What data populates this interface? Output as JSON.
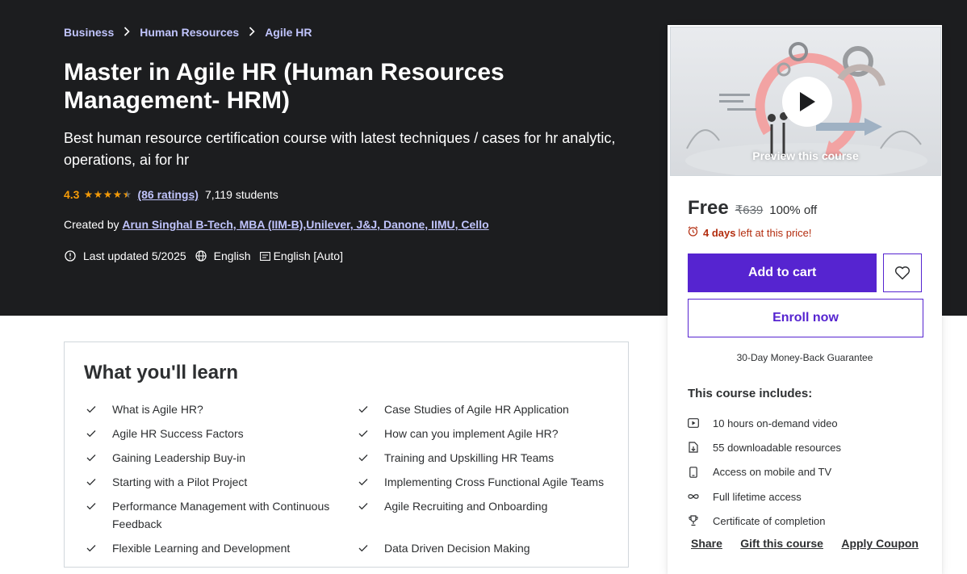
{
  "breadcrumb": [
    "Business",
    "Human Resources",
    "Agile HR"
  ],
  "course": {
    "title": "Master in Agile HR (Human Resources Management- HRM)",
    "subtitle": "Best human resource certification course with latest techniques / cases for hr analytic, operations, ai for hr",
    "rating": "4.3",
    "rating_stars": 4.3,
    "ratings_count": "(86 ratings)",
    "students": "7,119 students",
    "created_by_label": "Created by",
    "creator": "Arun Singhal B-Tech, MBA (IIM-B),Unilever, J&J, Danone, IIMU, Cello",
    "last_updated": "Last updated 5/2025",
    "language": "English",
    "captions": "English [Auto]"
  },
  "learn": {
    "title": "What you'll learn",
    "items": [
      "What is Agile HR?",
      "Case Studies of Agile HR Application",
      "Agile HR Success Factors",
      "How can you implement Agile HR?",
      "Gaining Leadership Buy-in",
      "Training and Upskilling HR Teams",
      "Starting with a Pilot Project",
      "Implementing Cross Functional Agile Teams",
      "Performance Management with Continuous Feedback",
      "Agile Recruiting and Onboarding",
      "Flexible Learning and Development",
      "Data Driven Decision Making"
    ]
  },
  "sidebar": {
    "preview_label": "Preview this course",
    "price": "Free",
    "original_price": "₹639",
    "discount": "100% off",
    "deadline_bold": "4 days",
    "deadline_rest": "left at this price!",
    "add_to_cart": "Add to cart",
    "enroll": "Enroll now",
    "guarantee": "30-Day Money-Back Guarantee",
    "includes_title": "This course includes:",
    "includes": [
      {
        "icon": "video-icon",
        "label": "10 hours on-demand video"
      },
      {
        "icon": "file-download-icon",
        "label": "55 downloadable resources"
      },
      {
        "icon": "mobile-icon",
        "label": "Access on mobile and TV"
      },
      {
        "icon": "infinity-icon",
        "label": "Full lifetime access"
      },
      {
        "icon": "trophy-icon",
        "label": "Certificate of completion"
      }
    ],
    "share": "Share",
    "gift": "Gift this course",
    "coupon": "Apply Coupon"
  },
  "colors": {
    "hero_bg": "#1c1d1f",
    "link_light": "#c0c4fc",
    "star": "#f69c08",
    "primary": "#5624d0",
    "deadline": "#b32d0f"
  }
}
